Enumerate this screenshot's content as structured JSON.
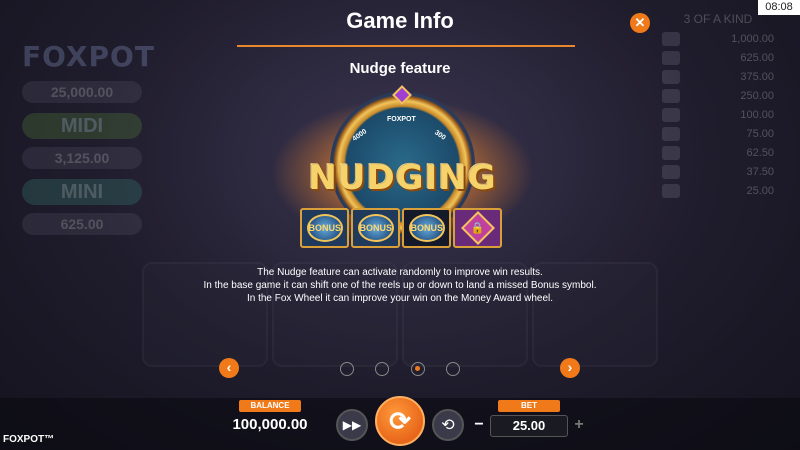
{
  "background": {
    "logo": "FOXPOT",
    "jackpots": [
      {
        "value": "25,000.00"
      },
      {
        "title": "MIDI",
        "value": "3,125.00"
      },
      {
        "title": "MINI",
        "value": "625.00"
      }
    ],
    "paytable_header": "3 OF A KIND",
    "paytable": [
      "1,000.00",
      "625.00",
      "375.00",
      "250.00",
      "100.00",
      "75.00",
      "62.50",
      "37.50",
      "25.00"
    ]
  },
  "header": {
    "title": "Game Info",
    "close_icon": "close-icon",
    "clock": "08:08"
  },
  "feature": {
    "subtitle": "Nudge feature",
    "art_text": "NUDGING",
    "wheel_labels": {
      "top": "FOXPOT",
      "left": "4000",
      "right": "300"
    },
    "symbols": [
      {
        "kind": "bonus",
        "label": "BONUS"
      },
      {
        "kind": "bonus",
        "label": "BONUS"
      },
      {
        "kind": "dark",
        "label": "BONUS"
      },
      {
        "kind": "lock",
        "label": "lock-icon"
      }
    ],
    "description": [
      "The Nudge feature can activate randomly to improve win results.",
      "In the base game it can shift one of the reels up or down to land a missed Bonus symbol.",
      "In the Fox Wheel it can improve your win on the Money Award wheel."
    ]
  },
  "pager": {
    "prev_icon": "chevron-left-icon",
    "next_icon": "chevron-right-icon",
    "page_count": 4,
    "active_page": 3
  },
  "bottom_bar": {
    "brand": "FOXPOT™",
    "balance_label": "BALANCE",
    "balance_value": "100,000.00",
    "autoplay_icon": "fast-forward-icon",
    "spin_icon": "spin-icon",
    "quickspin_icon": "refresh-icon",
    "bet_label": "BET",
    "bet_value": "25.00",
    "bet_minus": "−",
    "bet_plus": "+"
  },
  "colors": {
    "accent": "#f07a1a",
    "gold": "#f5d36a"
  }
}
